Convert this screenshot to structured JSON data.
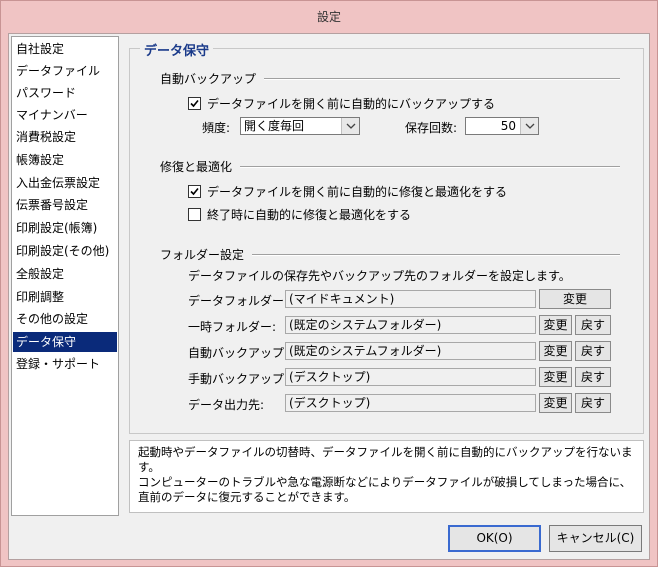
{
  "window": {
    "title": "設定"
  },
  "sidebar": {
    "items": [
      {
        "label": "自社設定"
      },
      {
        "label": "データファイル"
      },
      {
        "label": "パスワード"
      },
      {
        "label": "マイナンバー"
      },
      {
        "label": "消費税設定"
      },
      {
        "label": "帳簿設定"
      },
      {
        "label": "入出金伝票設定"
      },
      {
        "label": "伝票番号設定"
      },
      {
        "label": "印刷設定(帳簿)"
      },
      {
        "label": "印刷設定(その他)"
      },
      {
        "label": "全般設定"
      },
      {
        "label": "印刷調整"
      },
      {
        "label": "その他の設定"
      },
      {
        "label": "データ保守"
      },
      {
        "label": "登録・サポート"
      }
    ],
    "selected_label": "データ保守"
  },
  "panel": {
    "title": "データ保守",
    "auto_backup": {
      "title": "自動バックアップ",
      "checkbox_label": "データファイルを開く前に自動的にバックアップする",
      "checked": true,
      "frequency_label": "頻度:",
      "frequency_value": "開く度毎回",
      "count_label": "保存回数:",
      "count_value": "50"
    },
    "repair": {
      "title": "修復と最適化",
      "before_open_label": "データファイルを開く前に自動的に修復と最適化をする",
      "before_open_checked": true,
      "on_exit_label": "終了時に自動的に修復と最適化をする",
      "on_exit_checked": false
    },
    "folders": {
      "title": "フォルダー設定",
      "description": "データファイルの保存先やバックアップ先のフォルダーを設定します。",
      "change_label": "変更",
      "reset_label": "戻す",
      "rows": [
        {
          "label": "データフォルダー:",
          "value": "(マイドキュメント)"
        },
        {
          "label": "一時フォルダー:",
          "value": "(既定のシステムフォルダー)"
        },
        {
          "label": "自動バックアップ:",
          "value": "(既定のシステムフォルダー)"
        },
        {
          "label": "手動バックアップ:",
          "value": "(デスクトップ)"
        },
        {
          "label": "データ出力先:",
          "value": "(デスクトップ)"
        }
      ]
    }
  },
  "help_text": {
    "line1": "起動時やデータファイルの切替時、データファイルを開く前に自動的にバックアップを行ないます。",
    "line2": "コンピューターのトラブルや急な電源断などによりデータファイルが破損してしまった場合に、直前のデータに復元することができます。"
  },
  "footer": {
    "ok_label": "OK(O)",
    "cancel_label": "キャンセル(C)"
  }
}
